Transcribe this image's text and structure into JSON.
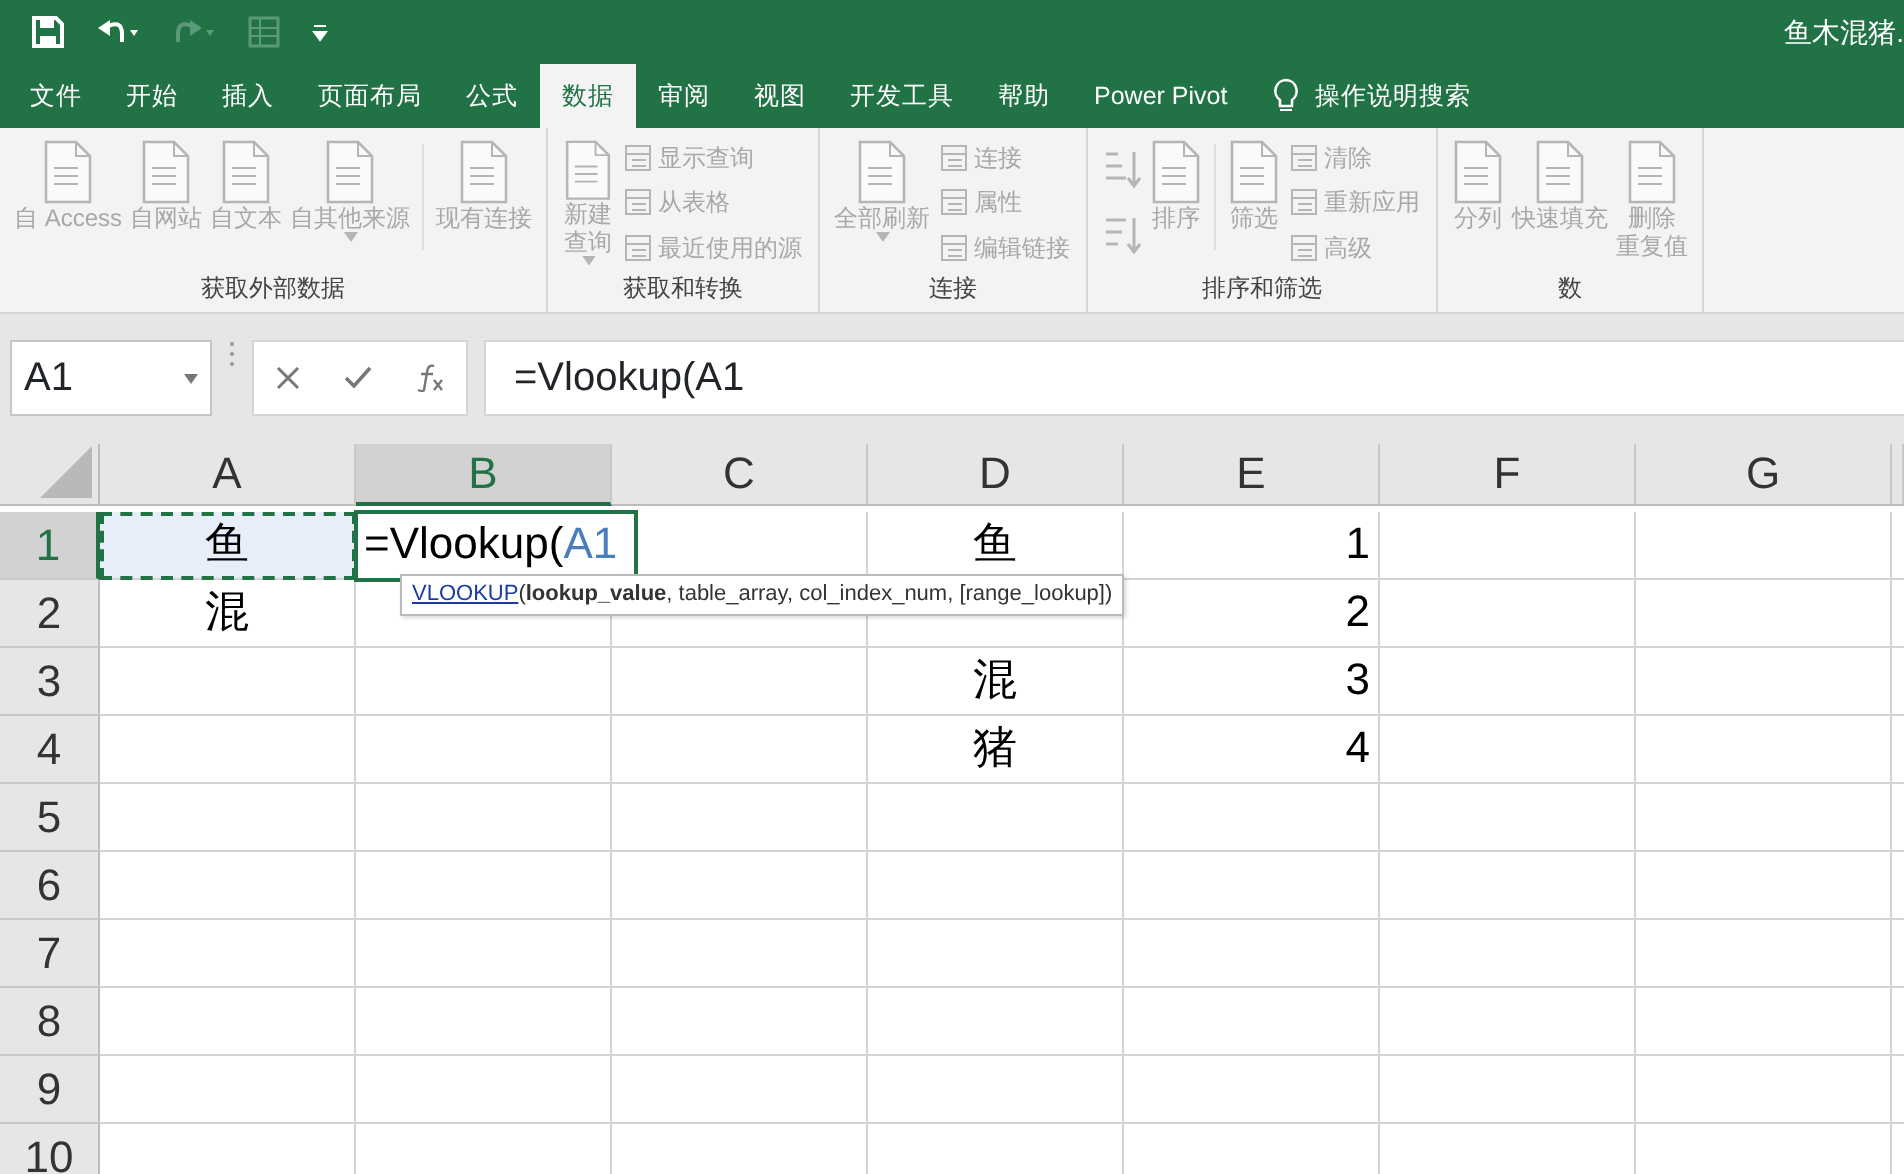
{
  "title_bar": {
    "document_title": "鱼木混猪."
  },
  "tabs": [
    {
      "label": "文件",
      "selected": false
    },
    {
      "label": "开始",
      "selected": false
    },
    {
      "label": "插入",
      "selected": false
    },
    {
      "label": "页面布局",
      "selected": false
    },
    {
      "label": "公式",
      "selected": false
    },
    {
      "label": "数据",
      "selected": true
    },
    {
      "label": "审阅",
      "selected": false
    },
    {
      "label": "视图",
      "selected": false
    },
    {
      "label": "开发工具",
      "selected": false
    },
    {
      "label": "帮助",
      "selected": false
    },
    {
      "label": "Power Pivot",
      "selected": false
    }
  ],
  "tell_me": "操作说明搜索",
  "ribbon": {
    "disabled": true,
    "groups": [
      {
        "label": "获取外部数据",
        "items": [
          {
            "kind": "large",
            "label": "自 Access"
          },
          {
            "kind": "large",
            "label": "自网站"
          },
          {
            "kind": "large",
            "label": "自文本"
          },
          {
            "kind": "large",
            "label": "自其他来源",
            "dropdown": true
          },
          {
            "kind": "separator"
          },
          {
            "kind": "large",
            "label": "现有连接"
          }
        ]
      },
      {
        "label": "获取和转换",
        "items": [
          {
            "kind": "large",
            "lines": [
              "新建",
              "查询"
            ],
            "dropdown": true
          },
          {
            "kind": "stack",
            "items": [
              "显示查询",
              "从表格",
              "最近使用的源"
            ]
          }
        ]
      },
      {
        "label": "连接",
        "items": [
          {
            "kind": "large",
            "label": "全部刷新",
            "dropdown": true
          },
          {
            "kind": "stack",
            "items": [
              "连接",
              "属性",
              "编辑链接"
            ]
          }
        ]
      },
      {
        "label": "排序和筛选",
        "items": [
          {
            "kind": "sort_icons"
          },
          {
            "kind": "large",
            "label": "排序"
          },
          {
            "kind": "separator"
          },
          {
            "kind": "large",
            "label": "筛选"
          },
          {
            "kind": "stack",
            "items": [
              "清除",
              "重新应用",
              "高级"
            ]
          }
        ]
      },
      {
        "label": "数",
        "items": [
          {
            "kind": "large",
            "label": "分列"
          },
          {
            "kind": "large",
            "label": "快速填充"
          },
          {
            "kind": "large",
            "lines": [
              "删除",
              "重复值"
            ]
          }
        ]
      }
    ]
  },
  "formula_bar": {
    "name_box": "A1",
    "formula": "=Vlookup(A1"
  },
  "sheet": {
    "columns": [
      {
        "label": "A",
        "selected": false
      },
      {
        "label": "B",
        "selected": true
      },
      {
        "label": "C",
        "selected": false
      },
      {
        "label": "D",
        "selected": false
      },
      {
        "label": "E",
        "selected": false
      },
      {
        "label": "F",
        "selected": false
      },
      {
        "label": "G",
        "selected": false
      }
    ],
    "rows": [
      {
        "label": "1",
        "selected": true,
        "cells": [
          {
            "kind": "text",
            "text": "鱼",
            "referenced": true
          },
          {
            "kind": "editing",
            "text": "=Vlookup(",
            "reference": "A1"
          },
          null,
          {
            "kind": "text",
            "text": "鱼"
          },
          {
            "kind": "number",
            "text": "1"
          },
          null,
          null
        ]
      },
      {
        "label": "2",
        "selected": false,
        "cells": [
          {
            "kind": "text",
            "text": "混"
          },
          null,
          null,
          null,
          {
            "kind": "number",
            "text": "2"
          },
          null,
          null
        ]
      },
      {
        "label": "3",
        "selected": false,
        "cells": [
          null,
          null,
          null,
          {
            "kind": "text",
            "text": "混"
          },
          {
            "kind": "number",
            "text": "3"
          },
          null,
          null
        ]
      },
      {
        "label": "4",
        "selected": false,
        "cells": [
          null,
          null,
          null,
          {
            "kind": "text",
            "text": "猪"
          },
          {
            "kind": "number",
            "text": "4"
          },
          null,
          null
        ]
      },
      {
        "label": "5",
        "selected": false,
        "cells": []
      },
      {
        "label": "6",
        "selected": false,
        "cells": []
      },
      {
        "label": "7",
        "selected": false,
        "cells": []
      },
      {
        "label": "8",
        "selected": false,
        "cells": []
      },
      {
        "label": "9",
        "selected": false,
        "cells": []
      },
      {
        "label": "10",
        "selected": false,
        "cells": []
      }
    ],
    "tooltip": {
      "function": "VLOOKUP",
      "arguments": "(**lookup_value**, table_array, col_index_num, [range_lookup])"
    }
  }
}
